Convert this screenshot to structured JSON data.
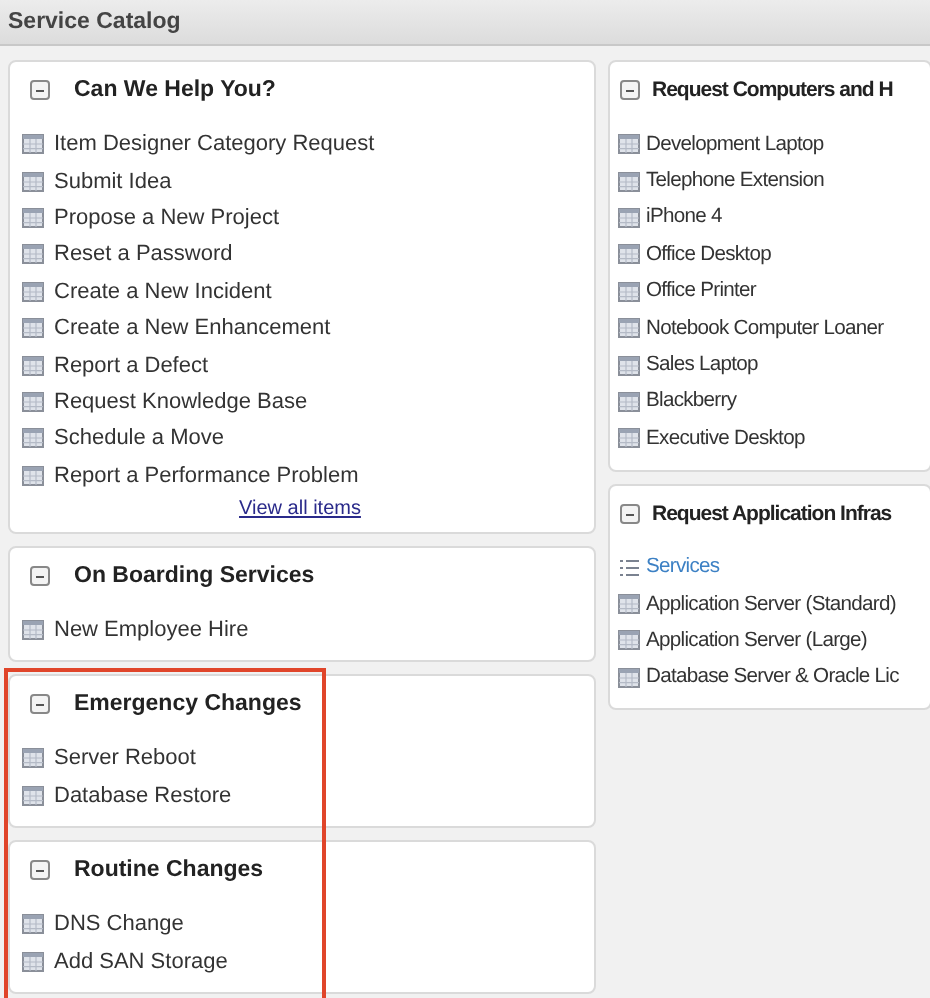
{
  "header": {
    "title": "Service Catalog"
  },
  "columns": [
    {
      "cards": [
        {
          "title": "Can We Help You?",
          "expanded": true,
          "highlighted": false,
          "items": [
            {
              "kind": "item",
              "label": "Item Designer Category Request"
            },
            {
              "kind": "item",
              "label": "Submit Idea"
            },
            {
              "kind": "item",
              "label": "Propose a New Project"
            },
            {
              "kind": "item",
              "label": "Reset a Password"
            },
            {
              "kind": "item",
              "label": "Create a New Incident"
            },
            {
              "kind": "item",
              "label": "Create a New Enhancement"
            },
            {
              "kind": "item",
              "label": "Report a Defect"
            },
            {
              "kind": "item",
              "label": "Request Knowledge Base"
            },
            {
              "kind": "item",
              "label": "Schedule a Move"
            },
            {
              "kind": "item",
              "label": "Report a Performance Problem"
            }
          ],
          "more_link": "View all items"
        },
        {
          "title": "On Boarding Services",
          "expanded": true,
          "highlighted": false,
          "items": [
            {
              "kind": "item",
              "label": "New Employee Hire"
            }
          ]
        },
        {
          "title": "Emergency Changes",
          "expanded": true,
          "highlighted": true,
          "items": [
            {
              "kind": "item",
              "label": "Server Reboot"
            },
            {
              "kind": "item",
              "label": "Database Restore"
            }
          ]
        },
        {
          "title": "Routine Changes",
          "expanded": true,
          "highlighted": true,
          "items": [
            {
              "kind": "item",
              "label": "DNS Change"
            },
            {
              "kind": "item",
              "label": "Add SAN Storage"
            }
          ]
        }
      ]
    },
    {
      "cards": [
        {
          "title": "Request Computers and H",
          "expanded": true,
          "highlighted": false,
          "items": [
            {
              "kind": "item",
              "label": "Development Laptop"
            },
            {
              "kind": "item",
              "label": "Telephone Extension"
            },
            {
              "kind": "item",
              "label": "iPhone 4"
            },
            {
              "kind": "item",
              "label": "Office Desktop"
            },
            {
              "kind": "item",
              "label": "Office Printer"
            },
            {
              "kind": "item",
              "label": "Notebook Computer Loaner"
            },
            {
              "kind": "item",
              "label": "Sales Laptop"
            },
            {
              "kind": "item",
              "label": "Blackberry"
            },
            {
              "kind": "item",
              "label": "Executive Desktop"
            }
          ]
        },
        {
          "title": "Request Application Infras",
          "expanded": true,
          "highlighted": false,
          "items": [
            {
              "kind": "category",
              "label": "Services"
            },
            {
              "kind": "item",
              "label": "Application Server (Standard)"
            },
            {
              "kind": "item",
              "label": "Application Server (Large)"
            },
            {
              "kind": "item",
              "label": "Database Server & Oracle Lic"
            }
          ]
        }
      ]
    }
  ]
}
